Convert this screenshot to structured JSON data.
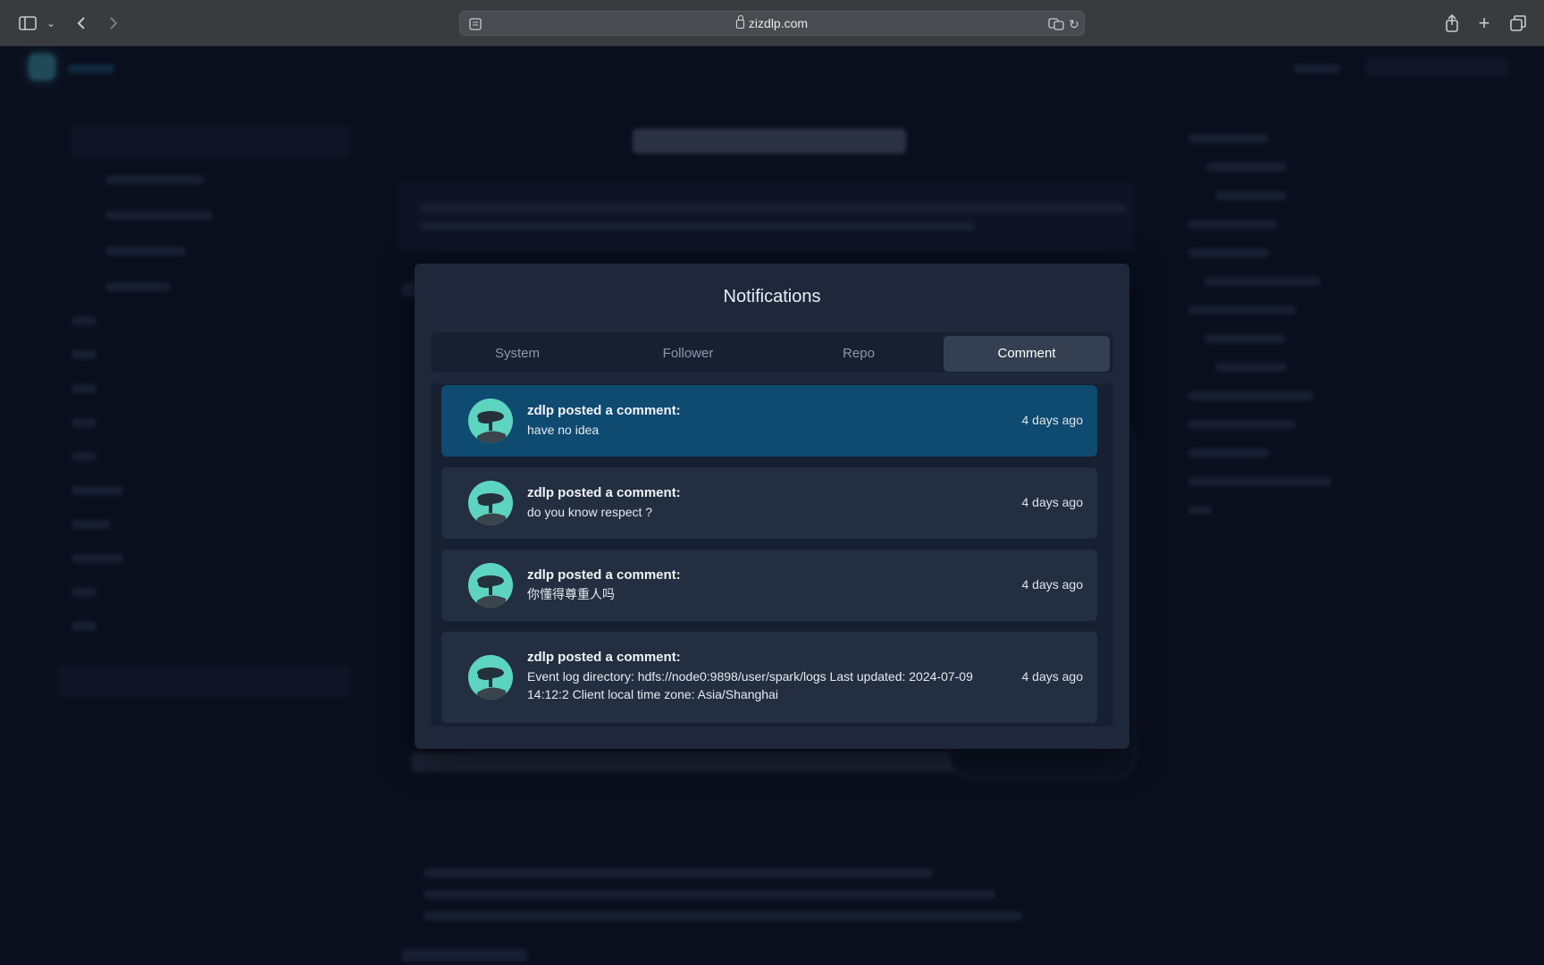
{
  "browser": {
    "url": "zizdlp.com"
  },
  "modal": {
    "title": "Notifications",
    "tabs": [
      {
        "label": "System"
      },
      {
        "label": "Follower"
      },
      {
        "label": "Repo"
      },
      {
        "label": "Comment"
      }
    ],
    "active_tab": "Comment",
    "notifications": [
      {
        "user": "zdlp",
        "action": "zdlp posted a comment:",
        "text": "have no idea",
        "time": "4 days ago",
        "highlighted": true
      },
      {
        "user": "zdlp",
        "action": "zdlp posted a comment:",
        "text": "do you know respect ?",
        "time": "4 days ago"
      },
      {
        "user": "zdlp",
        "action": "zdlp posted a comment:",
        "text": "你懂得尊重人吗",
        "time": "4 days ago"
      },
      {
        "user": "zdlp",
        "action": "zdlp posted a comment:",
        "text": "Event log directory: hdfs://node0:9898/user/spark/logs Last updated: 2024-07-09 14:12:2 Client local time zone: Asia/Shanghai",
        "time": "4 days ago"
      }
    ]
  },
  "colors": {
    "accent": "#0f4a71",
    "avatar": "#5cd4c0",
    "modal_bg": "#1e283a"
  }
}
